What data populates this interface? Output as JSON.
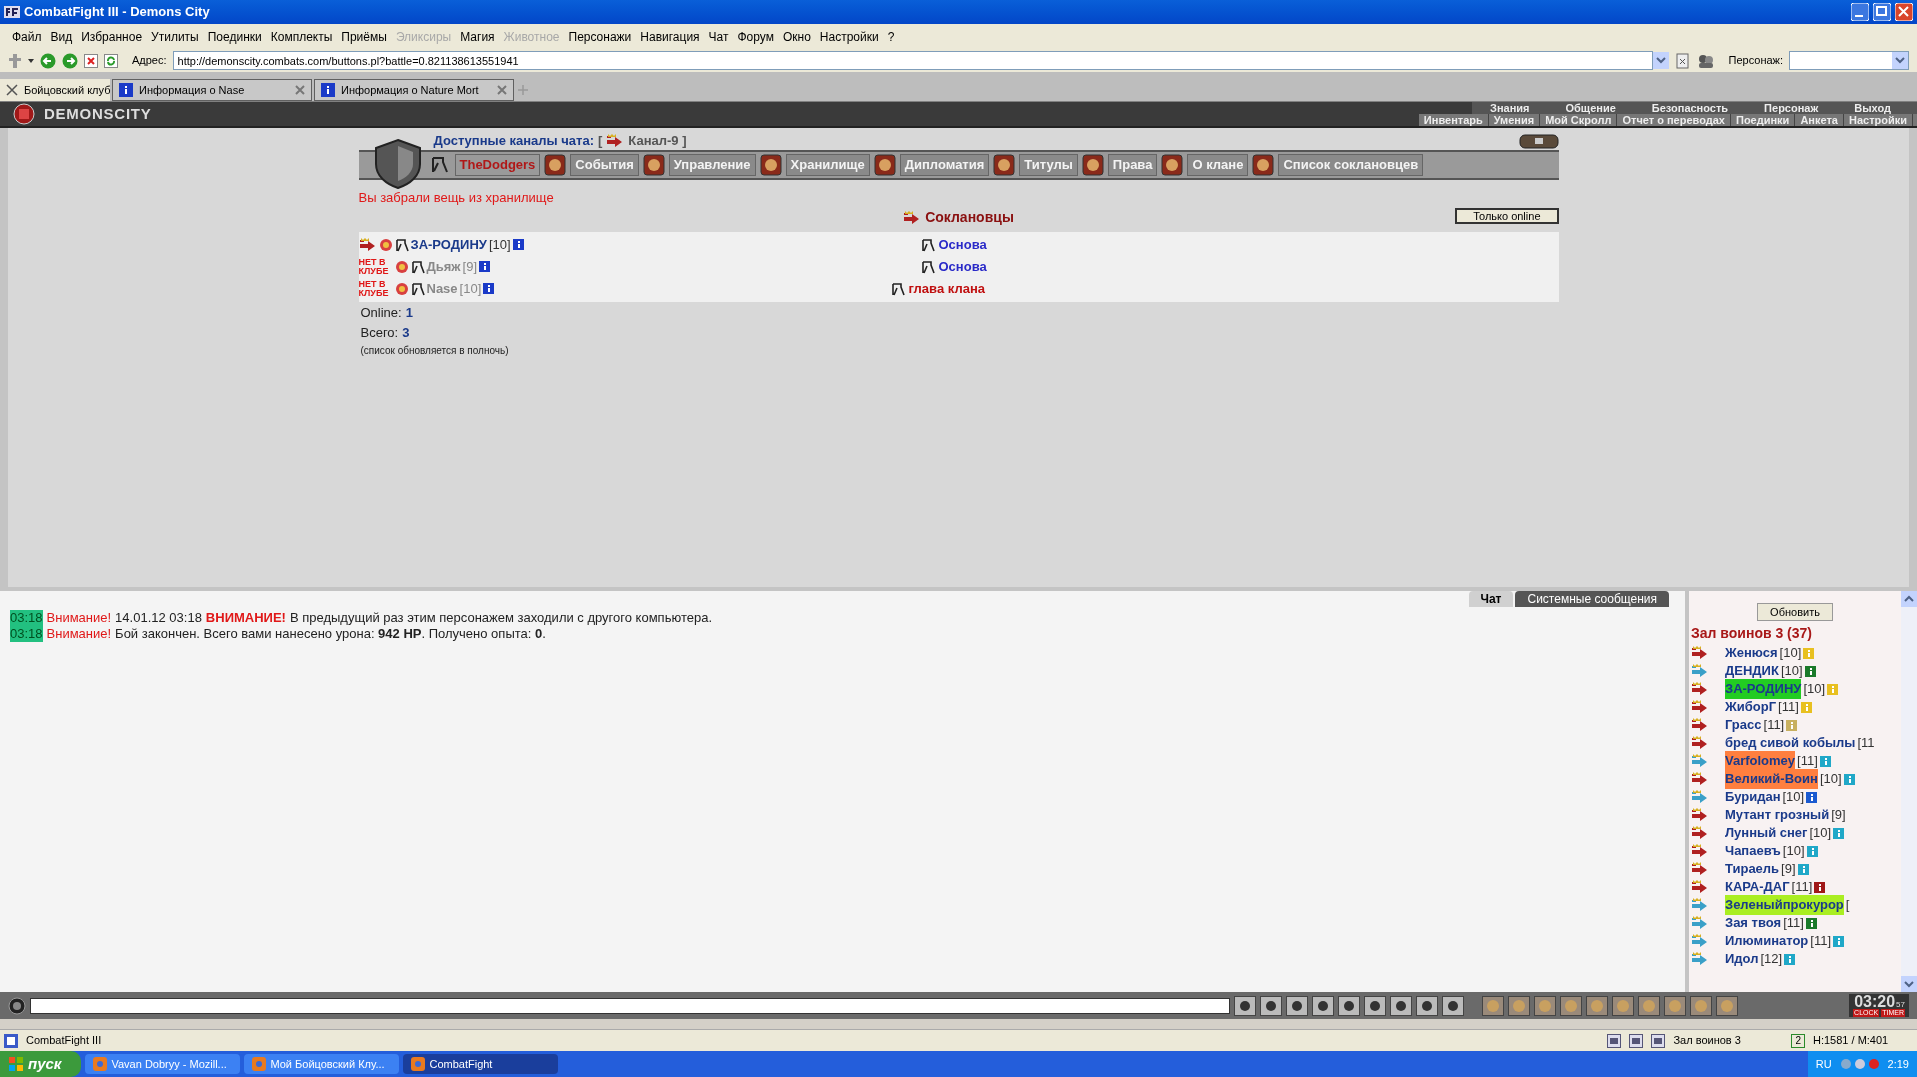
{
  "window": {
    "title": "CombatFight III - Demons City"
  },
  "menu": [
    {
      "label": "Файл",
      "disabled": false
    },
    {
      "label": "Вид",
      "disabled": false
    },
    {
      "label": "Избранное",
      "disabled": false
    },
    {
      "label": "Утилиты",
      "disabled": false
    },
    {
      "label": "Поединки",
      "disabled": false
    },
    {
      "label": "Комплекты",
      "disabled": false
    },
    {
      "label": "Приёмы",
      "disabled": false
    },
    {
      "label": "Эликсиры",
      "disabled": true
    },
    {
      "label": "Магия",
      "disabled": false
    },
    {
      "label": "Животное",
      "disabled": true
    },
    {
      "label": "Персонажи",
      "disabled": false
    },
    {
      "label": "Навигация",
      "disabled": false
    },
    {
      "label": "Чат",
      "disabled": false
    },
    {
      "label": "Форум",
      "disabled": false
    },
    {
      "label": "Окно",
      "disabled": false
    },
    {
      "label": "Настройки",
      "disabled": false
    },
    {
      "label": "?",
      "disabled": false
    }
  ],
  "address": {
    "label": "Адрес:",
    "value": "http://demonscity.combats.com/buttons.pl?battle=0.821138613551941"
  },
  "persona": {
    "label": "Персонаж:"
  },
  "tabs": [
    {
      "label": "Бойцовский клуб",
      "selected": true,
      "kind": "home"
    },
    {
      "label": "Информация о Nase",
      "selected": false,
      "kind": "info"
    },
    {
      "label": "Информация о Nature Mort",
      "selected": false,
      "kind": "info"
    }
  ],
  "game_header": {
    "logo": "DEMONSCITY",
    "nav_top": [
      "Знания",
      "Общение",
      "Безопасность",
      "Персонаж",
      "Выход"
    ],
    "nav_bottom": [
      "Инвентарь",
      "Умения",
      "Мой Скролл",
      "Отчет о переводах",
      "Поединки",
      "Анкета",
      "Настройки"
    ]
  },
  "clan": {
    "channels_label": "Доступные каналы чата:",
    "channel_open": "[",
    "channel": "Канал-9 ]",
    "nav": [
      {
        "label": "TheDodgers",
        "selected": true
      },
      {
        "label": "События",
        "selected": false
      },
      {
        "label": "Управление",
        "selected": false
      },
      {
        "label": "Хранилище",
        "selected": false
      },
      {
        "label": "Дипломатия",
        "selected": false
      },
      {
        "label": "Титулы",
        "selected": false
      },
      {
        "label": "Права",
        "selected": false
      },
      {
        "label": "О клане",
        "selected": false
      },
      {
        "label": "Список соклановцев",
        "selected": false
      }
    ],
    "notice": "Вы забрали вещь из хранилище",
    "section_title": "Соклановцы",
    "filter_button": "Только online",
    "members": [
      {
        "name": "ЗА-РОДИНУ",
        "level": "[10]",
        "online": true,
        "rank": "Основа",
        "kind": "member"
      },
      {
        "name": "Дьяж",
        "level": "[9]",
        "online": false,
        "presence": "НЕТ В КЛУБЕ",
        "rank": "Основа",
        "kind": "member"
      },
      {
        "name": "Nase",
        "level": "[10]",
        "online": false,
        "presence": "НЕТ В КЛУБЕ",
        "rank": "глава клана",
        "kind": "leader"
      }
    ],
    "online_label": "Online:",
    "online_value": "1",
    "total_label": "Всего:",
    "total_value": "3",
    "note": "(список обновляется в полночь)"
  },
  "chat": {
    "tabs": [
      {
        "label": "Чат",
        "selected": true
      },
      {
        "label": "Системные сообщения",
        "selected": false
      }
    ],
    "messages": [
      {
        "time": "03:18",
        "label": "Внимание!",
        "date": "14.01.12 03:18",
        "alert": "ВНИМАНИЕ!",
        "text": "В предыдущий раз этим персонажем заходили с другого компьютера."
      },
      {
        "time": "03:18",
        "label": "Внимание!",
        "text": "Бой закончен. Всего вами нанесено урона: **942 HP**. Получено опыта: **0**."
      }
    ]
  },
  "room": {
    "refresh_button": "Обновить",
    "title": "Зал воинов 3 (37)",
    "players": [
      {
        "name": "Женюся",
        "level": "[10]",
        "arrow": {
          "color": "#b02020"
        },
        "badge": {
          "color": "#e8c020"
        }
      },
      {
        "name": "ДЕНДИК",
        "level": "[10]",
        "arrow": {
          "color": "#3aa0c8"
        },
        "badge": {
          "color": "#1a7a2a"
        }
      },
      {
        "name": "ЗА-РОДИНУ",
        "level": "[10]",
        "arrow": {
          "color": "#b02020"
        },
        "badge": {
          "color": "#e8c020"
        },
        "highlight": {
          "color": "#22cc22"
        }
      },
      {
        "name": "ЖиборГ",
        "level": "[11]",
        "arrow": {
          "color": "#b02020"
        },
        "badge": {
          "color": "#e8c020"
        }
      },
      {
        "name": "Грасс",
        "level": "[11]",
        "arrow": {
          "color": "#b02020"
        },
        "badge": {
          "color": "#c8b060"
        }
      },
      {
        "name": "бред сивой кобылы",
        "level": "[11",
        "arrow": {
          "color": "#b02020"
        }
      },
      {
        "name": "Varfolomey",
        "level": "[11]",
        "arrow": {
          "color": "#3aa0c8"
        },
        "badge": {
          "color": "#20a8c8"
        },
        "highlight": {
          "color": "#ff7f3f"
        }
      },
      {
        "name": "Великий-Воин",
        "level": "[10]",
        "arrow": {
          "color": "#b02020"
        },
        "badge": {
          "color": "#20a8c8"
        },
        "highlight": {
          "color": "#ff7f3f"
        }
      },
      {
        "name": "Буридан",
        "level": "[10]",
        "arrow": {
          "color": "#3aa0c8"
        },
        "badge": {
          "color": "#1a5ad0"
        }
      },
      {
        "name": "Мутант грозный",
        "level": "[9]",
        "arrow": {
          "color": "#b02020"
        }
      },
      {
        "name": "Лунный снег",
        "level": "[10]",
        "arrow": {
          "color": "#b02020"
        },
        "badge": {
          "color": "#20a8c8"
        }
      },
      {
        "name": "Чапаевъ",
        "level": "[10]",
        "arrow": {
          "color": "#b02020"
        },
        "badge": {
          "color": "#20a8c8"
        }
      },
      {
        "name": "Тираель",
        "level": "[9]",
        "arrow": {
          "color": "#b02020"
        },
        "badge": {
          "color": "#20a8c8"
        }
      },
      {
        "name": "КАРА-ДАГ",
        "level": "[11]",
        "arrow": {
          "color": "#b02020"
        },
        "badge": {
          "color": "#a01818"
        }
      },
      {
        "name": "Зеленыйпрокурор",
        "level": "[",
        "arrow": {
          "color": "#3aa0c8"
        },
        "highlight": {
          "color": "#aaee22"
        }
      },
      {
        "name": "Зая твоя",
        "level": "[11]",
        "arrow": {
          "color": "#3aa0c8"
        },
        "badge": {
          "color": "#1a7a2a"
        }
      },
      {
        "name": "Илюминатор",
        "level": "[11]",
        "arrow": {
          "color": "#3aa0c8"
        },
        "badge": {
          "color": "#20a8c8"
        }
      },
      {
        "name": "Идол",
        "level": "[12]",
        "arrow": {
          "color": "#3aa0c8"
        },
        "badge": {
          "color": "#20a8c8"
        }
      }
    ]
  },
  "clock": {
    "time": "03:20",
    "seconds": "57",
    "clock_label": "CLOCK",
    "timer_label": "TIMER"
  },
  "status_bar": {
    "app": "CombatFight III",
    "room": "Зал воинов 3",
    "count": "2",
    "stats": "Н:1581 / М:401"
  },
  "taskbar": {
    "start": "пуск",
    "items": [
      {
        "label": "Vavan Dobryy - Mozill...",
        "selected": false
      },
      {
        "label": "Мой Бойцовский Клу...",
        "selected": false
      },
      {
        "label": "CombatFight",
        "selected": true
      }
    ],
    "lang": "RU",
    "time": "2:19"
  }
}
